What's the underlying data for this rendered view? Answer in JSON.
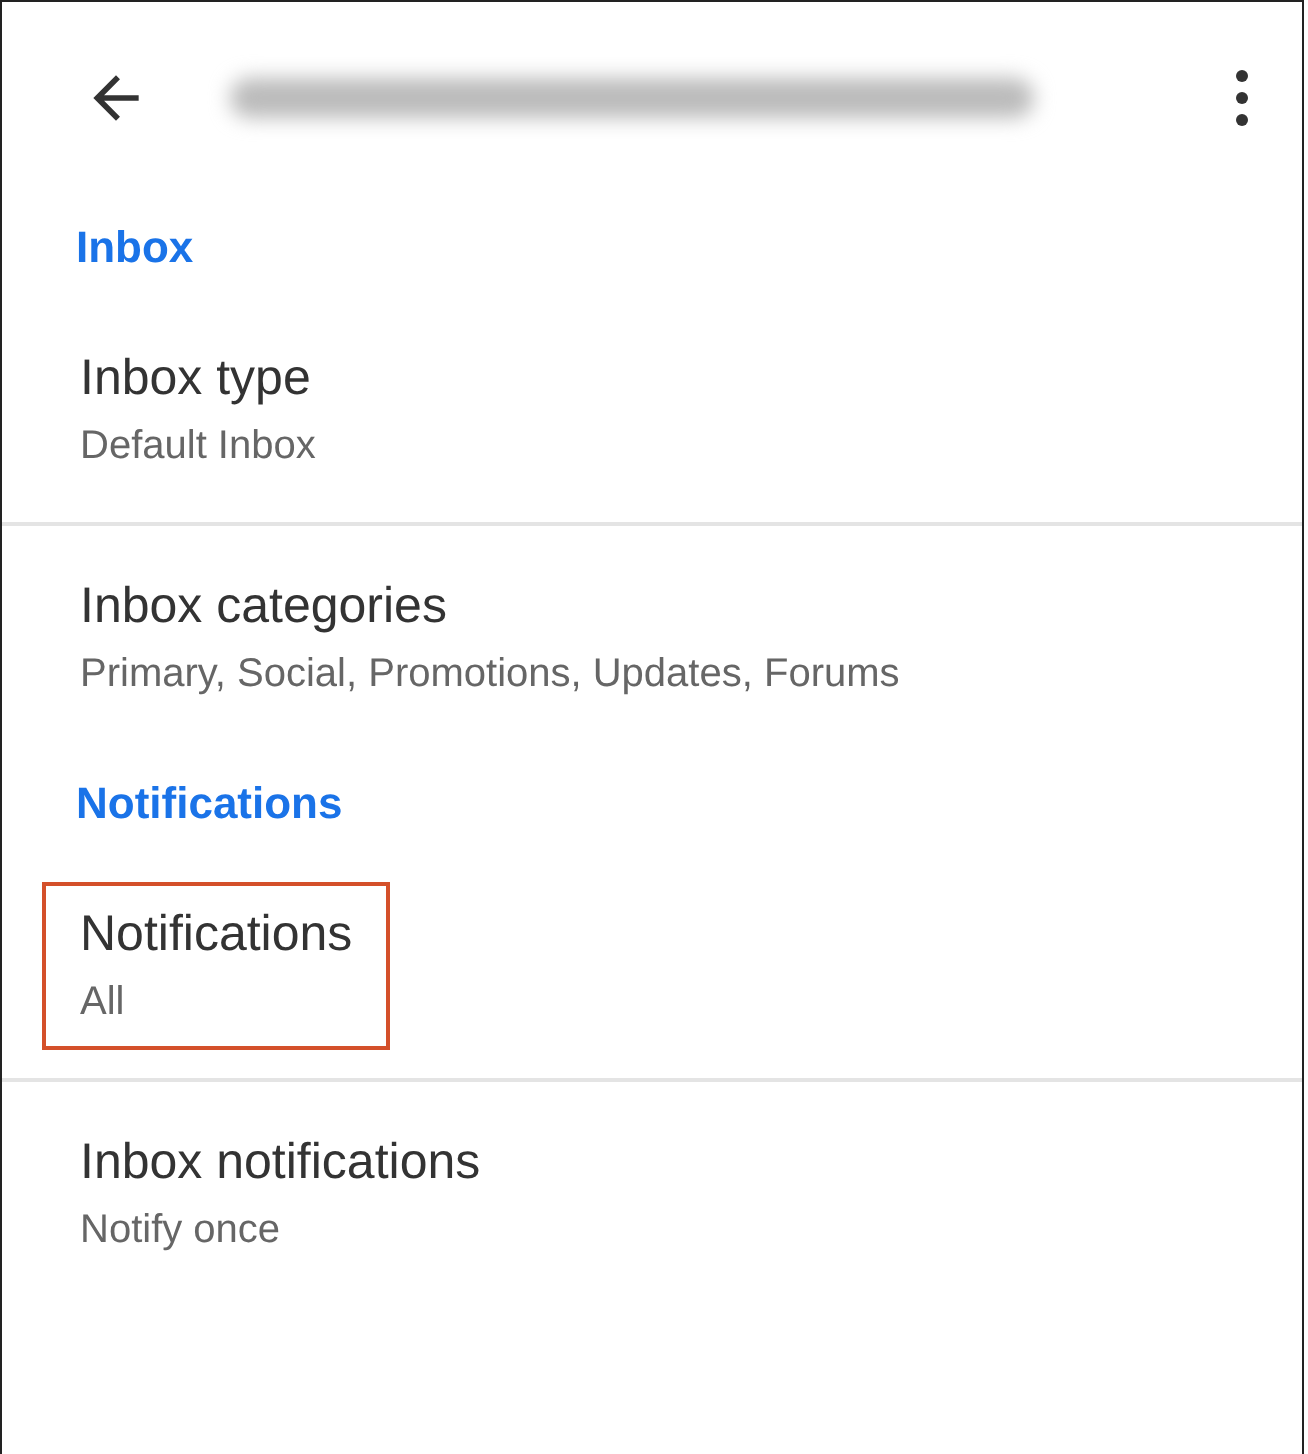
{
  "sections": [
    {
      "title": "Inbox",
      "items": [
        {
          "title": "Inbox type",
          "subtitle": "Default Inbox",
          "highlighted": false
        },
        {
          "title": "Inbox categories",
          "subtitle": "Primary, Social, Promotions, Updates, Forums",
          "highlighted": false
        }
      ]
    },
    {
      "title": "Notifications",
      "items": [
        {
          "title": "Notifications",
          "subtitle": "All",
          "highlighted": true
        },
        {
          "title": "Inbox notifications",
          "subtitle": "Notify once",
          "highlighted": false
        }
      ]
    }
  ]
}
